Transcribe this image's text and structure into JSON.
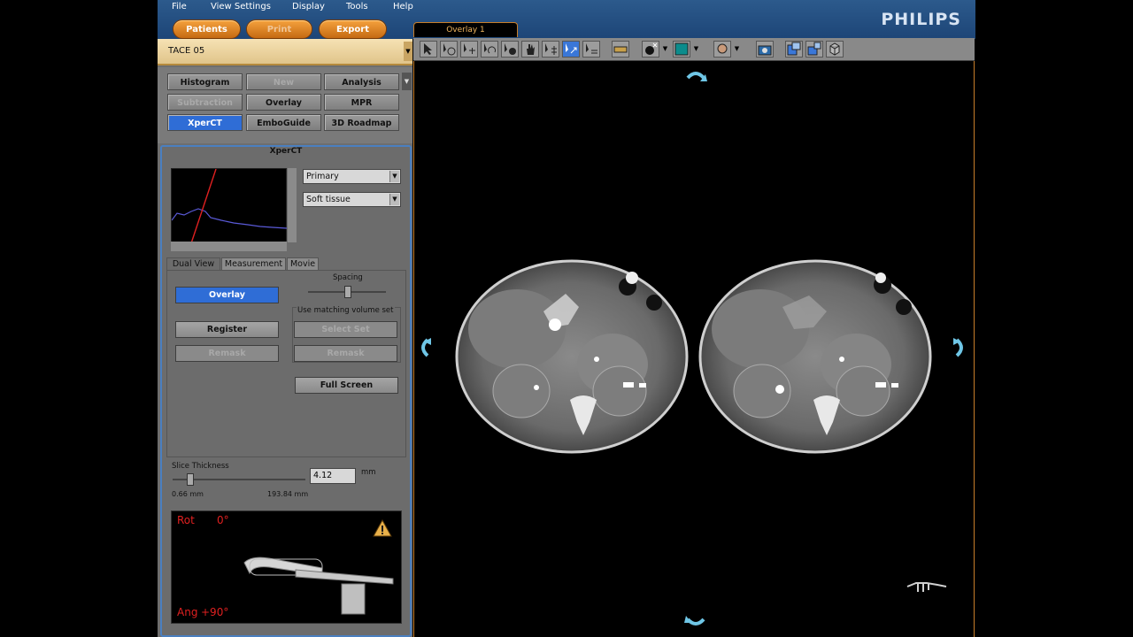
{
  "menu": [
    "File",
    "View Settings",
    "Display",
    "Tools",
    "Help"
  ],
  "brand": "PHILIPS",
  "top_buttons": [
    {
      "label": "Patients",
      "enabled": true
    },
    {
      "label": "Print",
      "enabled": false
    },
    {
      "label": "Export",
      "enabled": true
    }
  ],
  "study": {
    "name": "TACE 05"
  },
  "apps": [
    {
      "label": "Histogram",
      "enabled": true,
      "active": false
    },
    {
      "label": "New",
      "enabled": false,
      "active": false
    },
    {
      "label": "Analysis",
      "enabled": true,
      "active": false
    },
    {
      "label": "Subtraction",
      "enabled": false,
      "active": false
    },
    {
      "label": "Overlay",
      "enabled": true,
      "active": false
    },
    {
      "label": "MPR",
      "enabled": true,
      "active": false
    },
    {
      "label": "XperCT",
      "enabled": true,
      "active": true
    },
    {
      "label": "EmboGuide",
      "enabled": true,
      "active": false
    },
    {
      "label": "3D Roadmap",
      "enabled": true,
      "active": false
    }
  ],
  "xperct": {
    "title": "XperCT",
    "volume_select": "Primary",
    "preset_select": "Soft tissue",
    "tabs": [
      "Dual View",
      "Measurement",
      "Movie"
    ],
    "active_tab": "Dual View",
    "overlay_button": "Overlay",
    "spacing_label": "Spacing",
    "matching_label": "Use matching volume set",
    "register_button": "Register",
    "select_set_button": "Select Set",
    "remask_left": "Remask",
    "remask_right": "Remask",
    "fullscreen_button": "Full Screen",
    "slice_thickness_label": "Slice Thickness",
    "slice_thickness_value": "4.12",
    "slice_thickness_unit": "mm",
    "slice_min": "0.66 mm",
    "slice_max": "193.84 mm"
  },
  "geometry": {
    "rot_label": "Rot",
    "rot_value": "0°",
    "ang_label": "Ang",
    "ang_value": "+90°"
  },
  "viewer": {
    "tab": "Overlay 1"
  },
  "colors": {
    "accent": "#2f6dd6",
    "brand": "#d8e4f3",
    "orange": "#c77e2a"
  }
}
